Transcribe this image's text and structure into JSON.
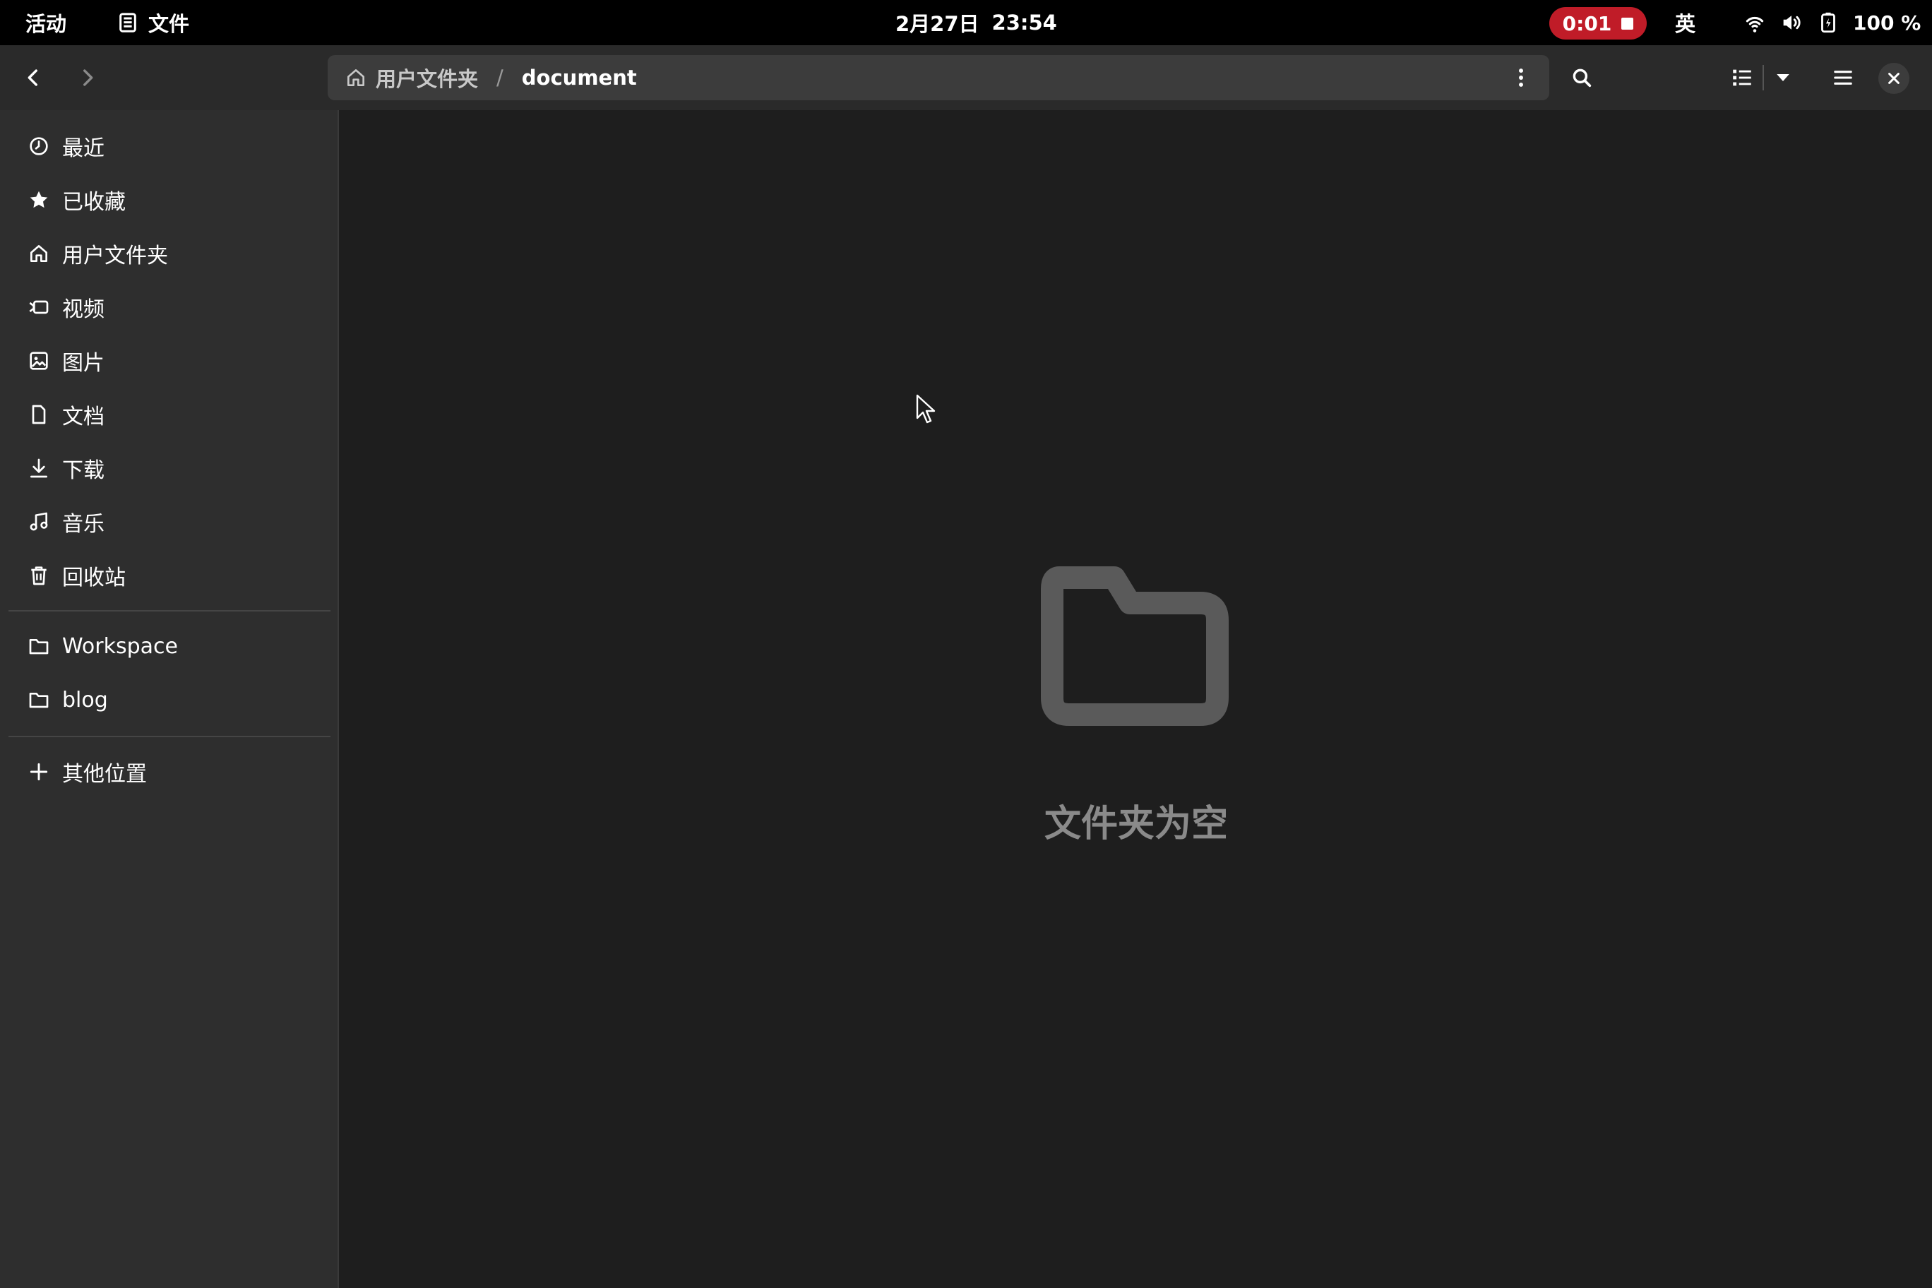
{
  "topbar": {
    "activities": "活动",
    "app_name": "文件",
    "date": "2月27日",
    "time": "23:54",
    "recording_time": "0:01",
    "input_method": "英",
    "battery": "100 %"
  },
  "headerbar": {
    "path_home": "用户文件夹",
    "path_separator": "/",
    "path_current": "document"
  },
  "sidebar": {
    "places": [
      {
        "label": "最近",
        "icon": "recent-icon"
      },
      {
        "label": "已收藏",
        "icon": "star-icon"
      },
      {
        "label": "用户文件夹",
        "icon": "home-icon"
      },
      {
        "label": "视频",
        "icon": "video-icon"
      },
      {
        "label": "图片",
        "icon": "image-icon"
      },
      {
        "label": "文档",
        "icon": "document-icon"
      },
      {
        "label": "下载",
        "icon": "download-icon"
      },
      {
        "label": "音乐",
        "icon": "music-icon"
      },
      {
        "label": "回收站",
        "icon": "trash-icon"
      }
    ],
    "bookmarks": [
      {
        "label": "Workspace",
        "icon": "folder-icon"
      },
      {
        "label": "blog",
        "icon": "folder-icon"
      }
    ],
    "other_locations": {
      "label": "其他位置",
      "icon": "plus-icon"
    }
  },
  "main": {
    "empty_message": "文件夹为空"
  },
  "colors": {
    "record_indicator": "#c01c28",
    "topbar_bg": "#000000",
    "sidebar_bg": "#2e2e2e",
    "content_bg": "#1e1e1e"
  }
}
